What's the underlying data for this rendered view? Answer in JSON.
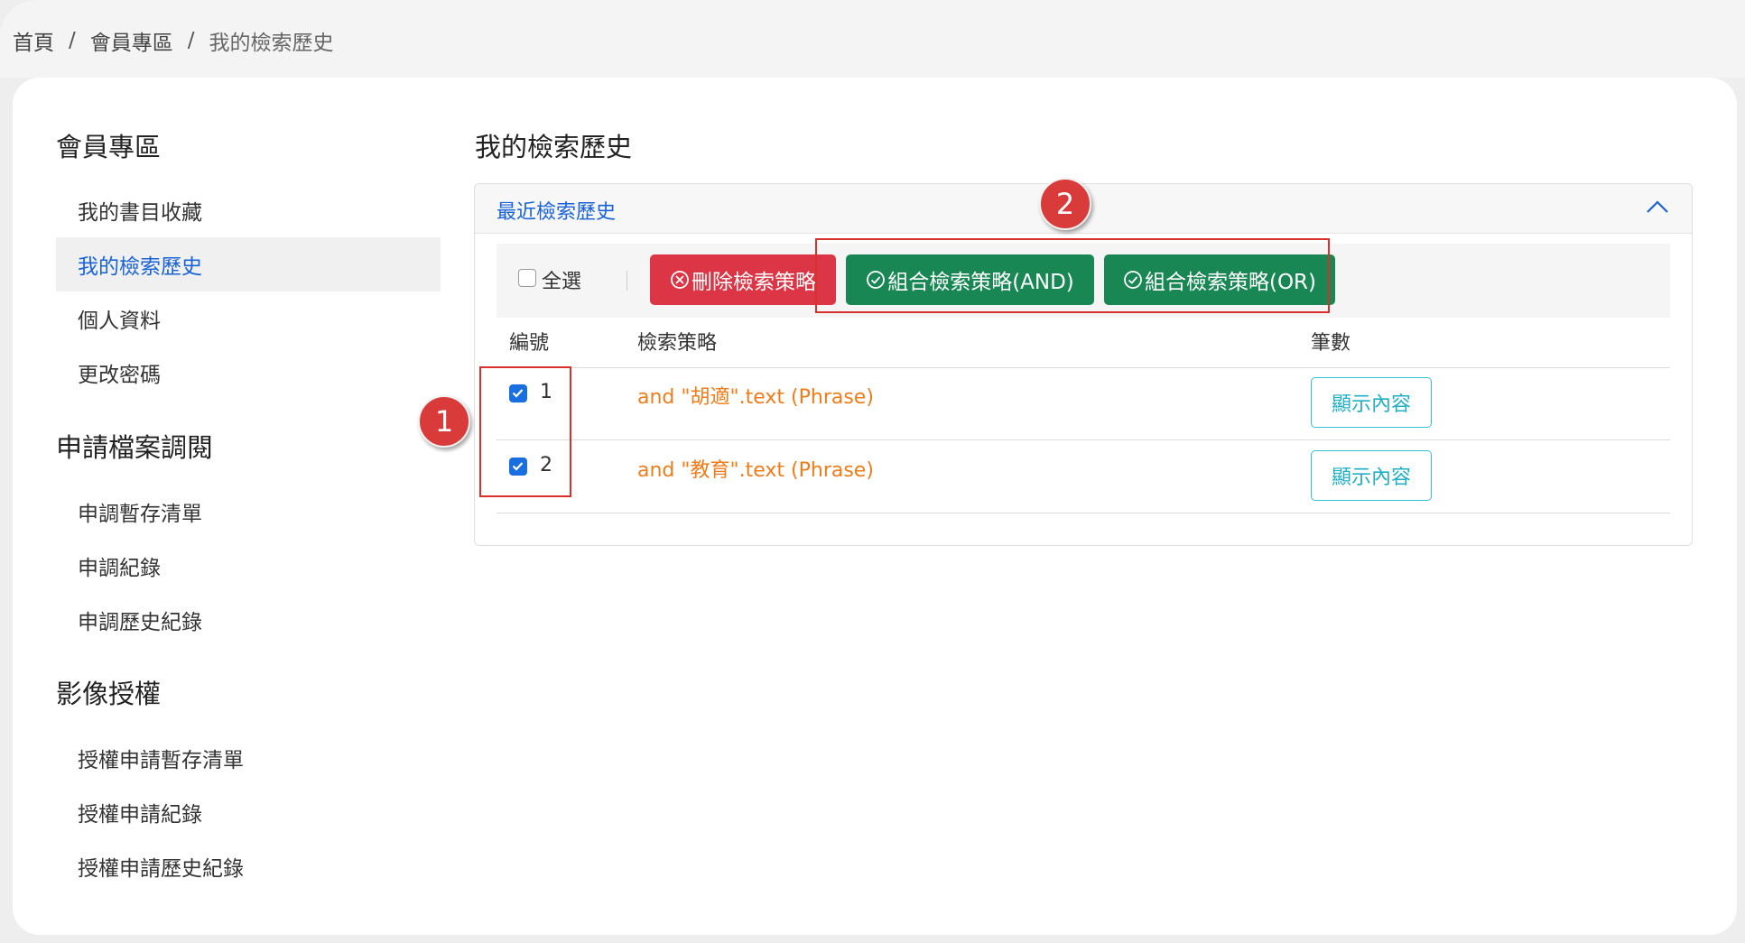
{
  "breadcrumb": [
    "首頁",
    "會員專區",
    "我的檢索歷史"
  ],
  "sidebar": {
    "groups": [
      {
        "title": "會員專區",
        "items": [
          "我的書目收藏",
          "我的檢索歷史",
          "個人資料",
          "更改密碼"
        ]
      },
      {
        "title": "申請檔案調閱",
        "items": [
          "申調暫存清單",
          "申調紀錄",
          "申調歷史紀錄"
        ]
      },
      {
        "title": "影像授權",
        "items": [
          "授權申請暫存清單",
          "授權申請紀錄",
          "授權申請歷史紀錄"
        ]
      }
    ],
    "active_item": "我的檢索歷史"
  },
  "main": {
    "title": "我的檢索歷史",
    "panel_title": "最近檢索歷史",
    "select_all_label": "全選",
    "buttons": {
      "delete": "刪除檢索策略",
      "combine_and": "組合檢索策略(AND)",
      "combine_or": "組合檢索策略(OR)"
    },
    "table": {
      "headers": [
        "編號",
        "檢索策略",
        "筆數"
      ],
      "rows": [
        {
          "num": "1",
          "strategy": "and \"胡適\".text (Phrase)",
          "button": "顯示內容",
          "checked": true
        },
        {
          "num": "2",
          "strategy": "and \"教育\".text (Phrase)",
          "button": "顯示內容",
          "checked": true
        }
      ]
    }
  },
  "annotations": {
    "marker1": "1",
    "marker2": "2"
  },
  "colors": {
    "accent_blue": "#1a63d6",
    "danger": "#dc3545",
    "success": "#198754",
    "strategy_text": "#f07c1a",
    "outline_info": "#33c1d4",
    "annotation": "#d9302c"
  }
}
